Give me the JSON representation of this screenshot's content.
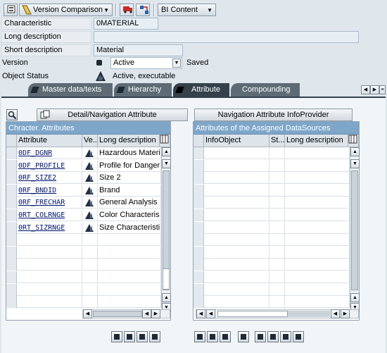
{
  "toolbar": {
    "version_comparison_label": "Version Comparison",
    "bi_content_label": "BI Content"
  },
  "header": {
    "characteristic_label": "Characteristic",
    "characteristic_value": "0MATERIAL",
    "long_description_label": "Long description",
    "long_description_value": "",
    "short_description_label": "Short description",
    "short_description_value": "Material",
    "version_label": "Version",
    "version_value": "Active",
    "version_status": "Saved",
    "object_status_label": "Object Status",
    "object_status_value": "Active, executable"
  },
  "tabs": [
    {
      "label": "Master data/texts"
    },
    {
      "label": "Hierarchy"
    },
    {
      "label": "Attribute"
    },
    {
      "label": "Compounding"
    }
  ],
  "buttons": {
    "detail_nav_attr": "Detail/Navigation Attribute",
    "nav_attr_infoprovider": "Navigation Attribute InfoProvider"
  },
  "left_table": {
    "title": "Chracter. Attributes",
    "columns": [
      "Attribute",
      "Ve...",
      "Long description"
    ],
    "rows": [
      {
        "attribute": "0DF_DGNR",
        "long": "Hazardous Materi"
      },
      {
        "attribute": "0DF_PROFILE",
        "long": "Profile for Danger"
      },
      {
        "attribute": "0RF_SIZE2",
        "long": "Size 2"
      },
      {
        "attribute": "0RF_BNDID",
        "long": "Brand"
      },
      {
        "attribute": "0RF_FRECHAR",
        "long": "General Analysis"
      },
      {
        "attribute": "0RT_COLRNGE",
        "long": "Color Characteris"
      },
      {
        "attribute": "0RT_SIZRNGE",
        "long": "Size Characteristi"
      }
    ]
  },
  "right_table": {
    "title": "Attributes of the Assigned DataSources",
    "columns": [
      "InfoObject",
      "St...",
      "Long description"
    ]
  },
  "colors": {
    "table_title": "#7da6c9",
    "active_tab": "#34414a",
    "link": "#00156b"
  }
}
